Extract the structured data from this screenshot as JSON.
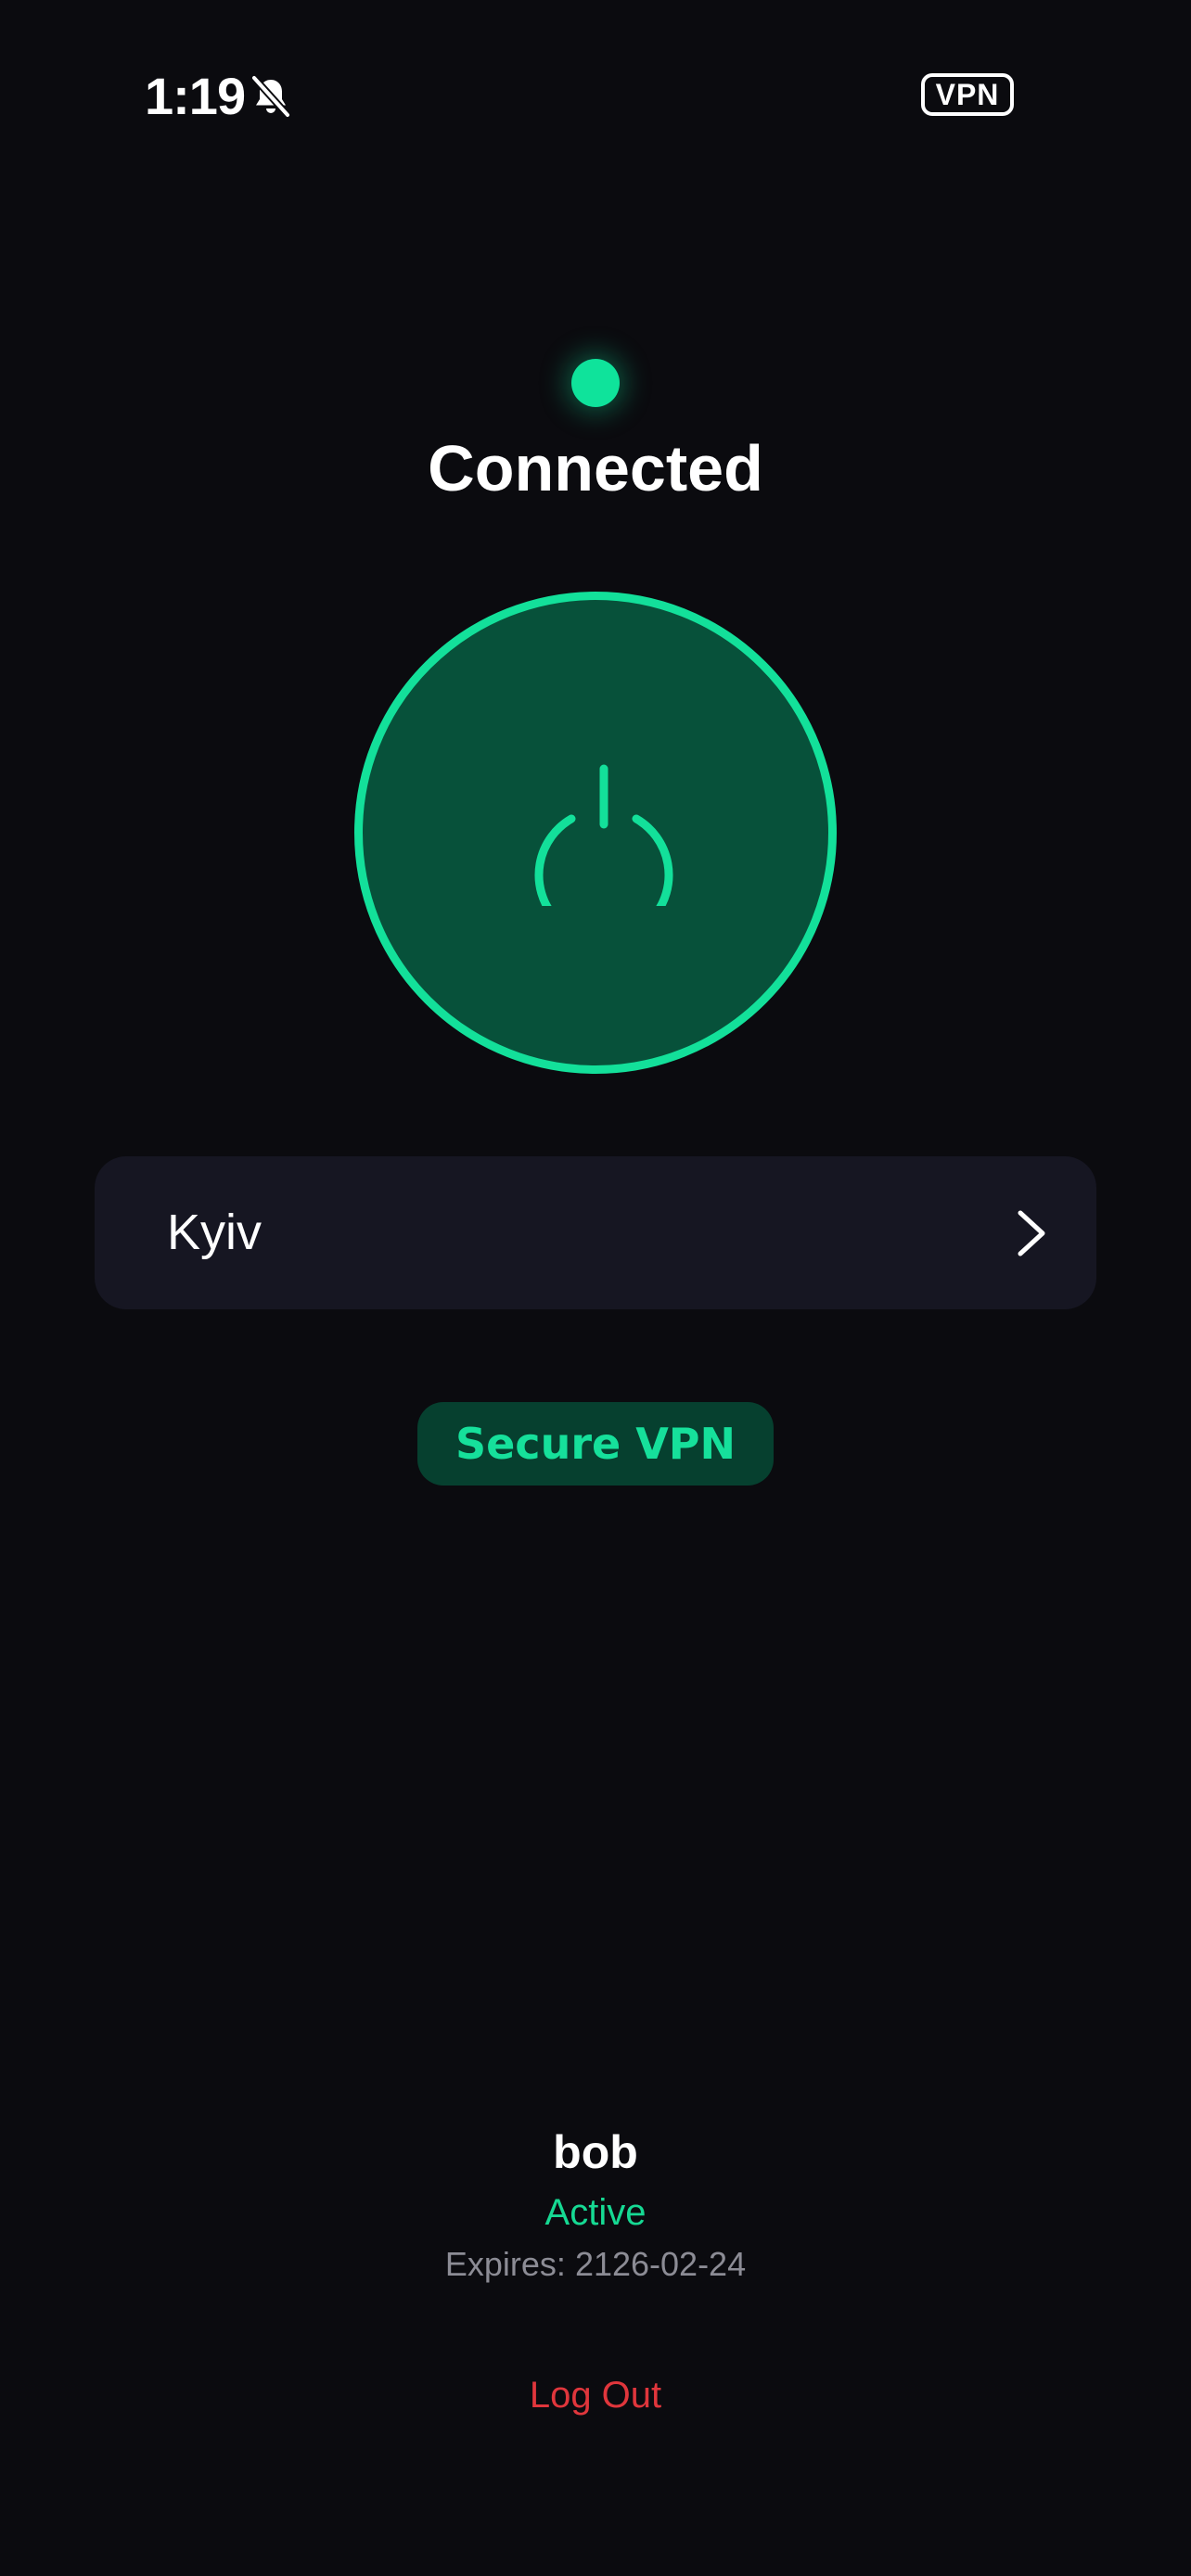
{
  "status_bar": {
    "time": "1:19",
    "silent_icon": "bell-slash-icon",
    "vpn_badge": "VPN"
  },
  "connection": {
    "state": "Connected",
    "indicator_color": "#0fe39b",
    "power_icon": "power-icon",
    "accent_color": "#13e09a"
  },
  "location": {
    "name": "Kyiv",
    "chevron_icon": "chevron-right-icon"
  },
  "app_badge": {
    "label": "Secure VPN"
  },
  "account": {
    "username": "bob",
    "status": "Active",
    "expires_label": "Expires:",
    "expires_date": "2126-02-24",
    "logout_label": "Log Out",
    "logout_color": "#e0363c"
  }
}
